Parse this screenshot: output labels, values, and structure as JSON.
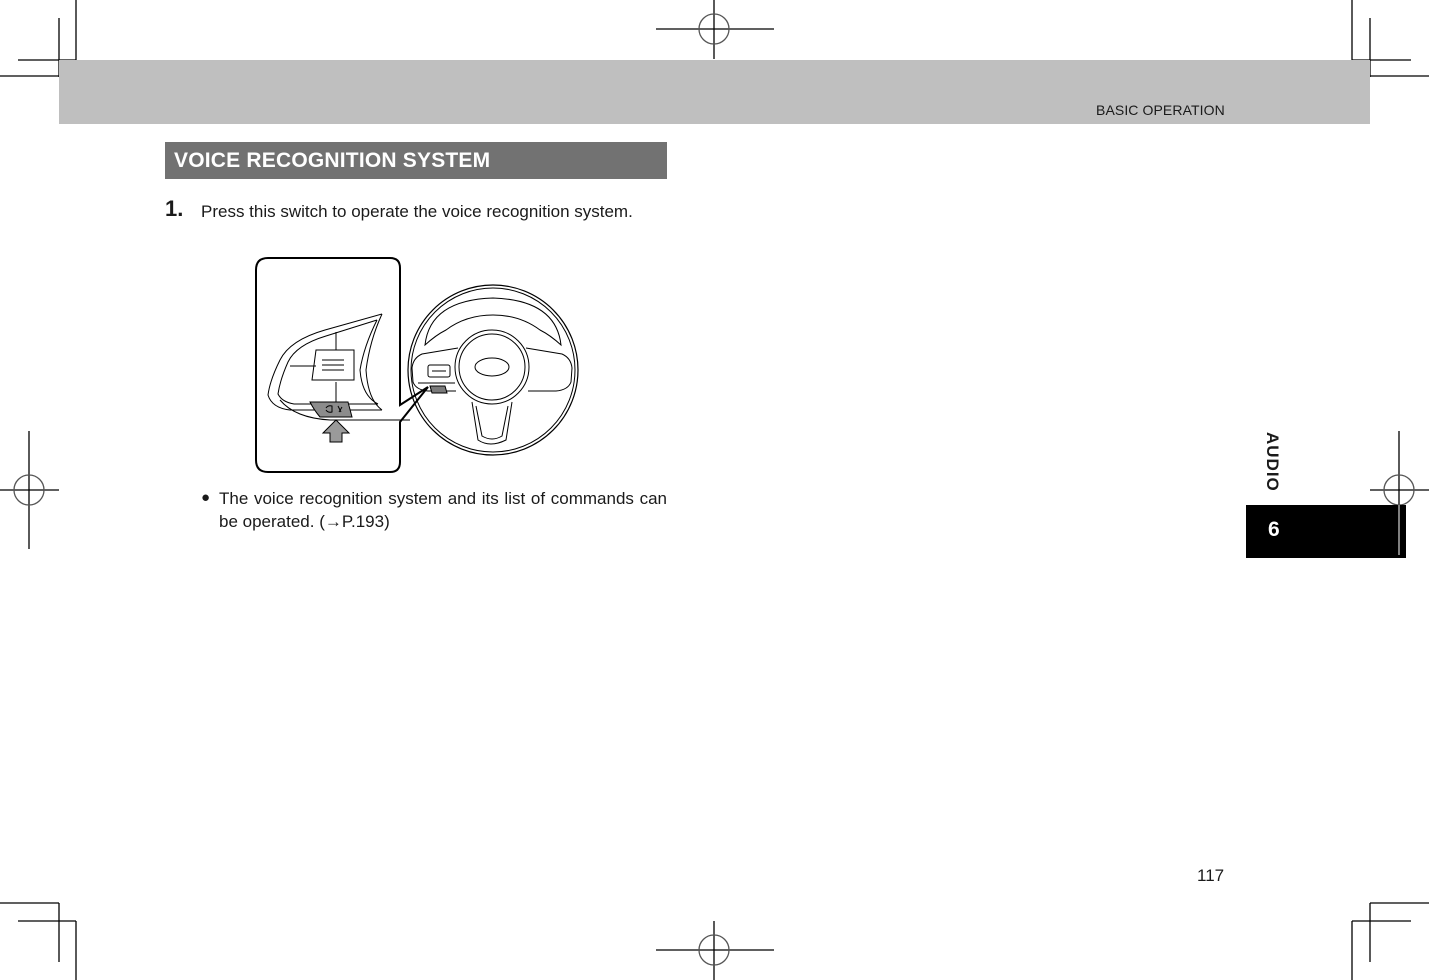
{
  "header": {
    "section_label": "BASIC OPERATION"
  },
  "section": {
    "title": "VOICE RECOGNITION SYSTEM"
  },
  "steps": [
    {
      "number": "1.",
      "text": "Press this switch to operate the voice recognition system."
    }
  ],
  "illustration": {
    "subject": "steering-wheel-voice-recognition-switch",
    "switch_icon": "talk-voice-icon",
    "highlight_color": "#808080"
  },
  "notes": [
    {
      "bullet": "●",
      "text": "The voice recognition system and its list of commands can be operated. (→P.193)"
    }
  ],
  "side_tab": {
    "chapter_label": "AUDIO",
    "chapter_number": "6"
  },
  "footer": {
    "page_number": "117"
  },
  "colors": {
    "header_band": "#bfbfbf",
    "section_bar": "#727272",
    "chapter_box": "#000000"
  }
}
